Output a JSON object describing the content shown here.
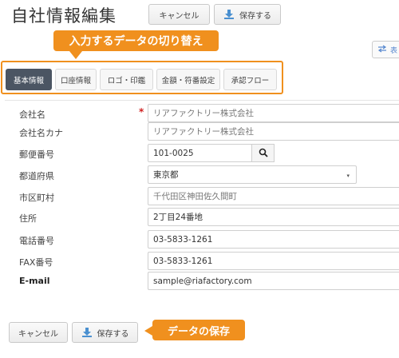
{
  "header": {
    "title": "自社情報編集",
    "cancel_label": "キャンセル",
    "save_label": "保存する"
  },
  "callouts": {
    "switch_input": "入力するデータの切り替え",
    "save_data": "データの保存"
  },
  "tabs": [
    {
      "label": "基本情報",
      "active": true
    },
    {
      "label": "口座情報",
      "active": false
    },
    {
      "label": "ロゴ・印鑑",
      "active": false
    },
    {
      "label": "金額・符番設定",
      "active": false
    },
    {
      "label": "承認フロー",
      "active": false
    }
  ],
  "right_button": {
    "label": "表"
  },
  "form": {
    "company_name": {
      "label": "会社名",
      "required_mark": "*",
      "value": "リアファクトリー株式会社"
    },
    "company_kana": {
      "label": "会社名カナ",
      "value": "リアファクトリー株式会社"
    },
    "postal_code": {
      "label": "郵便番号",
      "value": "101-0025"
    },
    "prefecture": {
      "label": "都道府県",
      "value": "東京都"
    },
    "city": {
      "label": "市区町村",
      "value": "千代田区神田佐久間町"
    },
    "address": {
      "label": "住所",
      "value": "2丁目24番地"
    },
    "phone": {
      "label": "電話番号",
      "value": "03-5833-1261"
    },
    "fax": {
      "label": "FAX番号",
      "value": "03-5833-1261"
    },
    "email": {
      "label": "E-mail",
      "value": "sample@riafactory.com"
    }
  },
  "footer": {
    "cancel_label": "キャンセル",
    "save_label": "保存する"
  },
  "colors": {
    "accent_orange": "#f0901e",
    "active_tab": "#4b5563",
    "download_icon": "#4a90d0",
    "required": "#d02020"
  },
  "icons": {
    "save": "download-icon",
    "search": "search-icon",
    "swap": "swap-icon",
    "dropdown": "chevron-down-icon"
  }
}
